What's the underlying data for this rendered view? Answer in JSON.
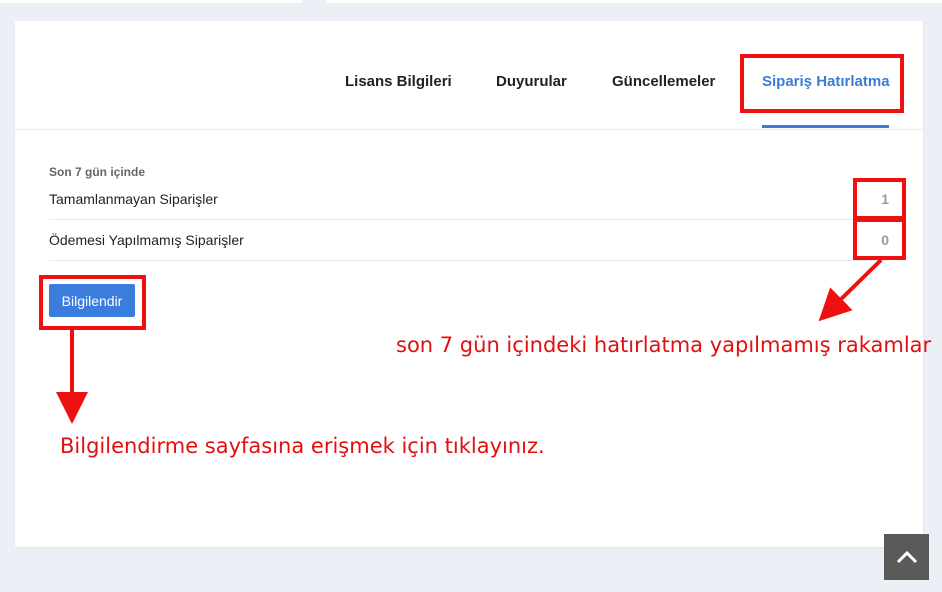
{
  "tabs": [
    {
      "label": "Lisans Bilgileri"
    },
    {
      "label": "Duyurular"
    },
    {
      "label": "Güncellemeler"
    },
    {
      "label": "Sipariş Hatırlatma"
    }
  ],
  "active_tab": "Sipariş Hatırlatma",
  "summary": {
    "period_label": "Son 7 gün içinde",
    "rows": [
      {
        "label": "Tamamlanmayan Siparişler",
        "value": "1"
      },
      {
        "label": "Ödemesi Yapılmamış Siparişler",
        "value": "0"
      }
    ]
  },
  "actions": {
    "inform_label": "Bilgilendir"
  },
  "annotations": {
    "numbers_note": "son 7 gün içindeki hatırlatma yapılmamış rakamlar",
    "button_note": "Bilgilendirme sayfasına erişmek için tıklayınız."
  },
  "colors": {
    "accent": "#3a7dd8",
    "annotation": "#ee1111",
    "background": "#eceff6"
  },
  "icons": {
    "scroll_top": "chevron-up-icon"
  }
}
